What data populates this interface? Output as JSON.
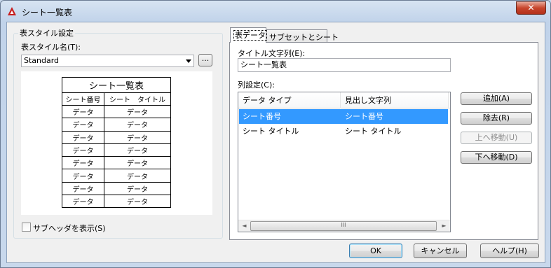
{
  "window": {
    "title": "シート一覧表",
    "close_label": "✕"
  },
  "left_group": {
    "label": "表スタイル設定",
    "style_name_label": "表スタイル名(T):",
    "style_name_value": "Standard",
    "ellipsis_label": "...",
    "preview": {
      "title": "シート一覧表",
      "headers": [
        "シート番号",
        "シート　タイトル"
      ],
      "rows": [
        [
          "データ",
          "データ"
        ],
        [
          "データ",
          "データ"
        ],
        [
          "データ",
          "データ"
        ],
        [
          "データ",
          "データ"
        ],
        [
          "データ",
          "データ"
        ],
        [
          "データ",
          "データ"
        ],
        [
          "データ",
          "データ"
        ],
        [
          "データ",
          "データ"
        ]
      ]
    },
    "show_subheader_label": "サブヘッダを表示(S)"
  },
  "tabs": [
    {
      "label": "表データ",
      "active": true
    },
    {
      "label": "サブセットとシート",
      "active": false
    }
  ],
  "table_data": {
    "title_string_label": "タイトル文字列(E):",
    "title_string_value": "シート一覧表",
    "column_settings_label": "列設定(C):",
    "columns": [
      "データ タイプ",
      "見出し文字列"
    ],
    "rows": [
      {
        "data_type": "シート番号",
        "heading": "シート番号",
        "selected": true
      },
      {
        "data_type": "シート タイトル",
        "heading": "シート タイトル",
        "selected": false
      }
    ],
    "scroll_left": "◄",
    "scroll_right": "►",
    "scroll_grip": "III",
    "buttons": {
      "add": "追加(A)",
      "remove": "除去(R)",
      "move_up": "上へ移動(U)",
      "move_down": "下へ移動(D)"
    }
  },
  "footer": {
    "ok": "OK",
    "cancel": "キャンセル",
    "help": "ヘルプ(H)"
  },
  "colors": {
    "selection": "#3399ff",
    "close_button": "#c7452c",
    "app_icon": "#c81e1e"
  }
}
